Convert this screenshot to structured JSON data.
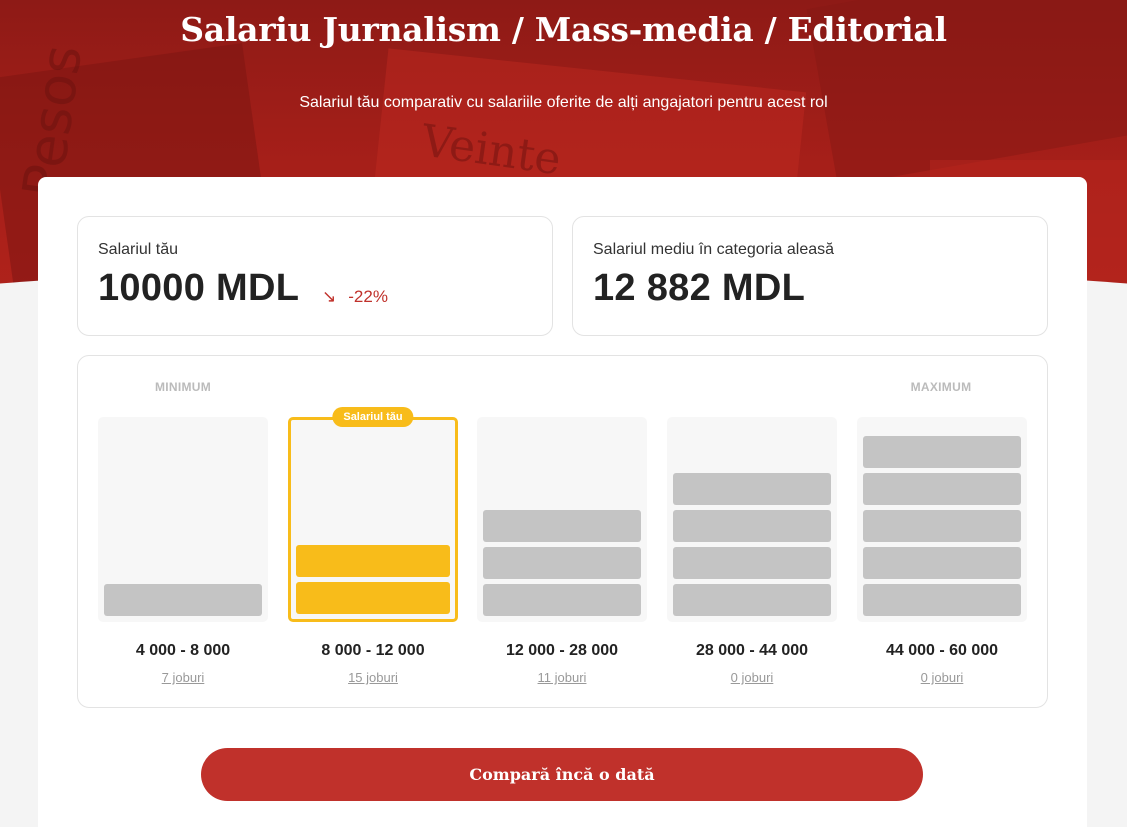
{
  "hero": {
    "title": "Salariu Jurnalism / Mass-media / Editorial",
    "subtitle": "Salariul tău comparativ cu salariile oferite de alți angajatori pentru acest rol",
    "background_color": "#a61f19"
  },
  "your_salary": {
    "label": "Salariul tău",
    "value": "10000 MDL",
    "diff_icon": "trend-down-arrow-icon",
    "diff_arrow": "↘",
    "diff": "-22%"
  },
  "average_salary": {
    "label": "Salariul mediu în categoria aleasă",
    "value": "12 882 MDL"
  },
  "distribution": {
    "min_label": "MINIMUM",
    "max_label": "MAXIMUM",
    "your_salary_badge": "Salariul tău",
    "highlight_color": "#f8bc1a",
    "bar_color": "#c4c4c4",
    "brackets": [
      {
        "range": "4 000 - 8 000",
        "jobs": "7 joburi",
        "level": 1,
        "highlighted": false
      },
      {
        "range": "8 000 - 12 000",
        "jobs": "15 joburi",
        "level": 2,
        "highlighted": true
      },
      {
        "range": "12 000 - 28 000",
        "jobs": "11 joburi",
        "level": 3,
        "highlighted": false
      },
      {
        "range": "28 000 - 44 000",
        "jobs": "0 joburi",
        "level": 4,
        "highlighted": false
      },
      {
        "range": "44 000 - 60 000",
        "jobs": "0 joburi",
        "level": 5,
        "highlighted": false
      }
    ]
  },
  "compare_button": {
    "label": "Compară încă o dată",
    "color": "#c0312b"
  }
}
